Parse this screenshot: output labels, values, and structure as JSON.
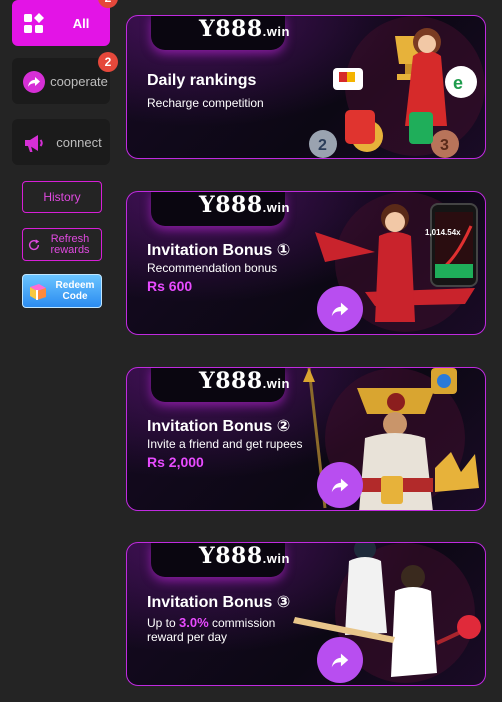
{
  "sidebar": {
    "all": {
      "label": "All",
      "badge": "2"
    },
    "cooperate": {
      "label": "cooperate",
      "badge": "2"
    },
    "connect": {
      "label": "connect"
    },
    "history": {
      "label": "History"
    },
    "refresh": {
      "line1": "Refresh",
      "line2": "rewards"
    },
    "redeem": {
      "line1": "Redeem",
      "line2": "Code"
    }
  },
  "banners": [
    {
      "brand": "Y888",
      "brand_suffix": ".win",
      "title": "Daily rankings",
      "subtitle": "Recharge competition"
    },
    {
      "brand": "Y888",
      "brand_suffix": ".win",
      "title": "Invitation Bonus ①",
      "subtitle": "Recommendation bonus",
      "amount": "Rs 600",
      "phone_multiplier": "1,014.54x"
    },
    {
      "brand": "Y888",
      "brand_suffix": ".win",
      "title": "Invitation Bonus ②",
      "subtitle": "Invite a friend and get rupees",
      "amount": "Rs 2,000"
    },
    {
      "brand": "Y888",
      "brand_suffix": ".win",
      "title": "Invitation Bonus ③",
      "line1_prefix": "Up to ",
      "line1_highlight": "3.0%",
      "line1_suffix": " commission",
      "line2": "reward per day"
    }
  ],
  "colors": {
    "accent": "#e314e6",
    "badge": "#e5483b",
    "banner_border": "#c02ae0",
    "share_button": "#b84ef0"
  },
  "icons": {
    "all": "grid-icon",
    "cooperate": "share-icon",
    "connect": "megaphone-icon",
    "refresh": "refresh-icon",
    "redeem": "gift-icon",
    "banner_action": "share-arrow-icon"
  }
}
